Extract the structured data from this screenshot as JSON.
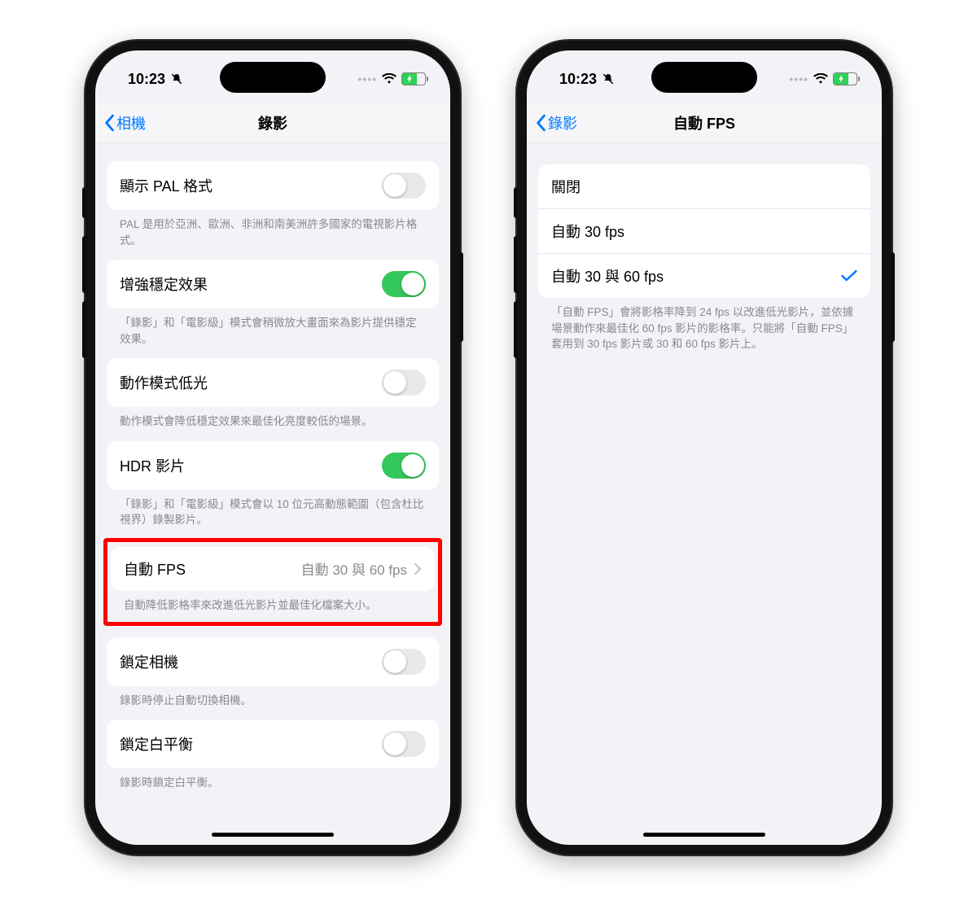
{
  "status": {
    "time": "10:23"
  },
  "phone1": {
    "nav": {
      "back": "相機",
      "title": "錄影"
    },
    "rows": {
      "pal": {
        "label": "顯示 PAL 格式",
        "on": false,
        "footer": "PAL 是用於亞洲、歐洲、非洲和南美洲許多國家的電視影片格式。"
      },
      "stab": {
        "label": "增強穩定效果",
        "on": true,
        "footer": "「錄影」和「電影級」模式會稍微放大畫面來為影片提供穩定效果。"
      },
      "lowlight": {
        "label": "動作模式低光",
        "on": false,
        "footer": "動作模式會降低穩定效果來最佳化亮度較低的場景。"
      },
      "hdr": {
        "label": "HDR 影片",
        "on": true,
        "footer": "「錄影」和「電影級」模式會以 10 位元高動態範圍（包含杜比視界）錄製影片。"
      },
      "autofps": {
        "label": "自動 FPS",
        "value": "自動 30 與 60 fps",
        "footer": "自動降低影格率來改進低光影片並最佳化檔案大小。"
      },
      "lockcam": {
        "label": "鎖定相機",
        "on": false,
        "footer": "錄影時停止自動切換相機。"
      },
      "lockwb": {
        "label": "鎖定白平衡",
        "on": false,
        "footer": "錄影時鎖定白平衡。"
      }
    }
  },
  "phone2": {
    "nav": {
      "back": "錄影",
      "title": "自動 FPS"
    },
    "options": [
      {
        "label": "關閉",
        "selected": false
      },
      {
        "label": "自動 30 fps",
        "selected": false
      },
      {
        "label": "自動 30 與 60 fps",
        "selected": true
      }
    ],
    "footer": "「自動 FPS」會將影格率降到 24 fps 以改進低光影片，並依據場景動作來最佳化 60 fps 影片的影格率。只能將「自動 FPS」套用到 30 fps 影片或 30 和 60 fps 影片上。"
  }
}
